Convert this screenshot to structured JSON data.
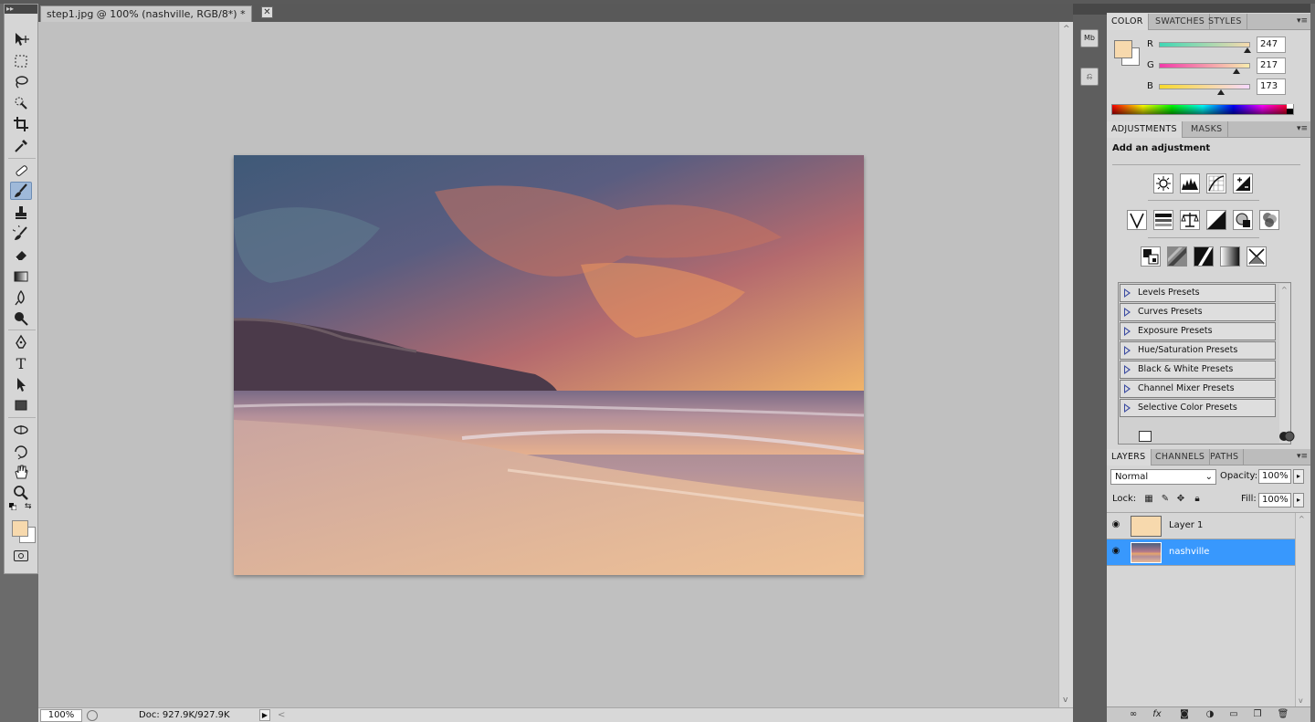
{
  "document": {
    "tab_title": "step1.jpg @ 100% (nashville, RGB/8*) *",
    "close_glyph": "✕"
  },
  "status": {
    "zoom": "100%",
    "doc_info": "Doc: 927.9K/927.9K",
    "arrow": "▶",
    "left_arrow": "<"
  },
  "colors": {
    "foreground": "#f7d9ad",
    "background": "#ffffff",
    "selection": "#3898fd"
  },
  "color_panel": {
    "tabs": [
      "COLOR",
      "SWATCHES",
      "STYLES"
    ],
    "active_tab": "COLOR",
    "channels": [
      {
        "label": "R",
        "value": "247",
        "level": 0.969
      },
      {
        "label": "G",
        "value": "217",
        "level": 0.851
      },
      {
        "label": "B",
        "value": "173",
        "level": 0.678
      }
    ]
  },
  "adjustments_panel": {
    "tabs": [
      "ADJUSTMENTS",
      "MASKS"
    ],
    "active_tab": "ADJUSTMENTS",
    "title": "Add an adjustment",
    "icon_rows": [
      [
        "brightness-contrast-icon",
        "levels-icon",
        "curves-icon",
        "exposure-icon"
      ],
      [
        "vibrance-icon",
        "hue-saturation-icon",
        "color-balance-icon",
        "black-white-icon",
        "photo-filter-icon",
        "channel-mixer-icon"
      ],
      [
        "invert-icon",
        "posterize-icon",
        "threshold-icon",
        "gradient-map-icon",
        "selective-color-icon"
      ]
    ],
    "presets": [
      "Levels Presets",
      "Curves Presets",
      "Exposure Presets",
      "Hue/Saturation Presets",
      "Black & White Presets",
      "Channel Mixer Presets",
      "Selective Color Presets"
    ]
  },
  "layers_panel": {
    "tabs": [
      "LAYERS",
      "CHANNELS",
      "PATHS"
    ],
    "active_tab": "LAYERS",
    "blend_mode": "Normal",
    "opacity_label": "Opacity:",
    "opacity": "100%",
    "lock_label": "Lock:",
    "fill_label": "Fill:",
    "fill": "100%",
    "layers": [
      {
        "name": "Layer 1",
        "visible": true,
        "selected": false,
        "thumb": "#f7d9ad"
      },
      {
        "name": "nashville",
        "visible": true,
        "selected": true,
        "thumb": "photo"
      }
    ]
  },
  "dock": {
    "mini_bridge_label": "Mb"
  },
  "tools": [
    "move-tool",
    "marquee-tool",
    "lasso-tool",
    "quick-selection-tool",
    "crop-tool",
    "eyedropper-tool",
    "spot-healing-tool",
    "brush-tool",
    "clone-stamp-tool",
    "history-brush-tool",
    "eraser-tool",
    "gradient-tool",
    "blur-tool",
    "dodge-tool",
    "pen-tool",
    "type-tool",
    "path-selection-tool",
    "rectangle-tool",
    "3d-rotate-tool",
    "3d-orbit-tool",
    "hand-tool",
    "zoom-tool"
  ],
  "active_tool": "brush-tool",
  "type_tool_glyph": "T"
}
